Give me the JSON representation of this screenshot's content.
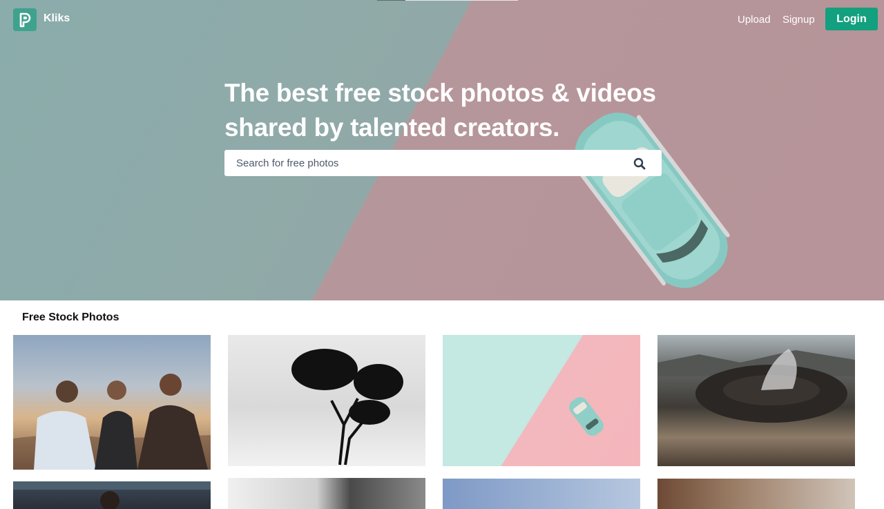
{
  "brand": {
    "name": "Kliks",
    "logo_icon": "p-logo-icon",
    "logo_color": "#3fa28e"
  },
  "nav": {
    "upload_label": "Upload",
    "signup_label": "Signup",
    "login_label": "Login",
    "login_color": "#12a07f"
  },
  "hero": {
    "title_line1": "The best free stock photos & videos",
    "title_line2": "shared by talented creators."
  },
  "search": {
    "placeholder": "Search for free photos",
    "value": "",
    "icon": "search-icon"
  },
  "section": {
    "title": "Free Stock Photos"
  },
  "photos": [
    {
      "subject": "three-men-talking-photo"
    },
    {
      "subject": "tree-silhouette-photo"
    },
    {
      "subject": "toy-car-pastel-photo"
    },
    {
      "subject": "volcano-crater-photo"
    },
    {
      "subject": "man-in-bookstore-photo"
    },
    {
      "subject": "blurred-building-photo"
    },
    {
      "subject": "blue-sky-photo"
    },
    {
      "subject": "bokeh-forest-photo"
    }
  ]
}
